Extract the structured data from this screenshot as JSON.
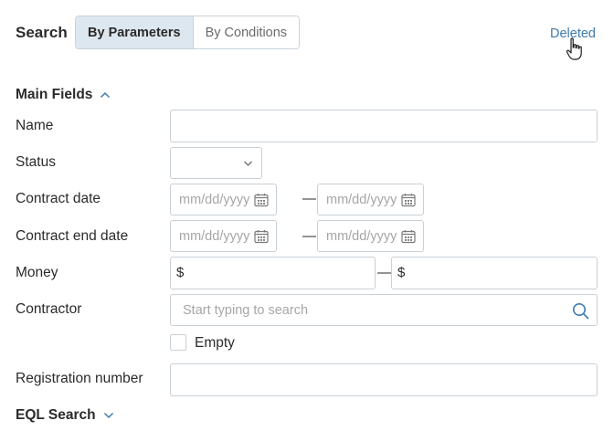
{
  "header": {
    "search_label": "Search",
    "tabs": [
      {
        "label": "By Parameters",
        "active": true
      },
      {
        "label": "By Conditions",
        "active": false
      }
    ],
    "deleted_link": "Deleted"
  },
  "main_fields": {
    "title": "Main Fields",
    "expanded": true,
    "name": {
      "label": "Name",
      "value": ""
    },
    "status": {
      "label": "Status",
      "value": ""
    },
    "contract_date": {
      "label": "Contract date",
      "from_placeholder": "mm/dd/yyyy",
      "to_placeholder": "mm/dd/yyyy",
      "separator": "—"
    },
    "contract_end_date": {
      "label": "Contract end date",
      "from_placeholder": "mm/dd/yyyy",
      "to_placeholder": "mm/dd/yyyy",
      "separator": "—"
    },
    "money": {
      "label": "Money",
      "currency_symbol": "$",
      "separator": "—"
    },
    "contractor": {
      "label": "Contractor",
      "placeholder": "Start typing to search",
      "empty_label": "Empty"
    },
    "registration_number": {
      "label": "Registration number",
      "value": ""
    }
  },
  "eql_search": {
    "title": "EQL Search",
    "expanded": false
  },
  "colors": {
    "accent": "#3d7bb0",
    "active_tab": "#dde7ef",
    "border": "#c9d0d6"
  }
}
